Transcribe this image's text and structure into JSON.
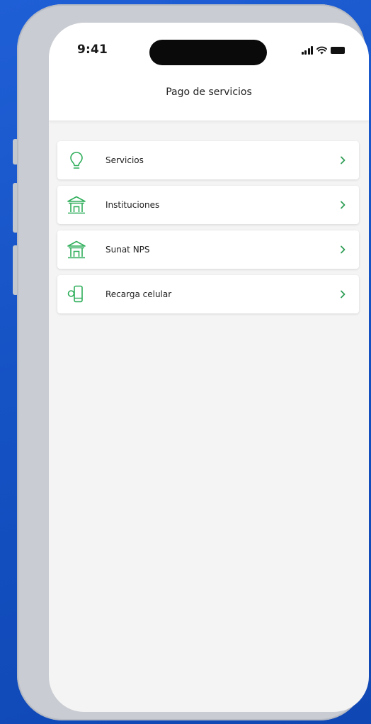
{
  "status_bar": {
    "time": "9:41"
  },
  "header": {
    "title": "Pago de servicios"
  },
  "menu": {
    "items": [
      {
        "label": "Servicios",
        "icon": "lightbulb-icon"
      },
      {
        "label": "Instituciones",
        "icon": "institution-building-icon"
      },
      {
        "label": "Sunat NPS",
        "icon": "institution-building-icon"
      },
      {
        "label": "Recarga celular",
        "icon": "mobile-recharge-icon"
      }
    ]
  },
  "colors": {
    "background": "#1552c4",
    "accent": "#2fae5a",
    "chevron": "#2e9e55",
    "frame": "#c9ccd2",
    "screen": "#f4f4f4"
  }
}
